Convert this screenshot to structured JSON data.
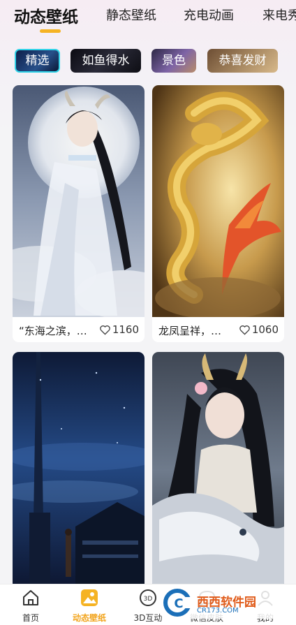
{
  "top_tabs": [
    {
      "label": "动态壁纸",
      "active": true
    },
    {
      "label": "静态壁纸",
      "active": false
    },
    {
      "label": "充电动画",
      "active": false
    },
    {
      "label": "来电秀",
      "active": false
    }
  ],
  "chips": [
    {
      "label": "精选",
      "selected": true,
      "color": "#1c2a52"
    },
    {
      "label": "如鱼得水",
      "selected": false,
      "color": "#1b1b24"
    },
    {
      "label": "景色",
      "selected": false,
      "color": "#5a4a7a"
    },
    {
      "label": "恭喜发财",
      "selected": false,
      "color": "#8a6a48"
    }
  ],
  "cards": [
    {
      "title": "“东海之滨，…",
      "likes": "1160",
      "scene": "moon-maiden-image"
    },
    {
      "title": "龙凤呈祥，…",
      "likes": "1060",
      "scene": "golden-dragon-phoenix-image"
    },
    {
      "title": "",
      "likes": "",
      "scene": "night-tower-city-image"
    },
    {
      "title": "",
      "likes": "",
      "scene": "horned-maiden-white-dragon-image"
    }
  ],
  "bottom_nav": [
    {
      "label": "首页",
      "icon": "home-icon",
      "active": false
    },
    {
      "label": "动态壁纸",
      "icon": "wallpaper-icon",
      "active": true
    },
    {
      "label": "3D互动",
      "icon": "3d-icon",
      "active": false
    },
    {
      "label": "微信皮肤",
      "icon": "wechat-skin-icon",
      "active": false
    },
    {
      "label": "我的",
      "icon": "profile-icon",
      "active": false
    }
  ],
  "watermark": {
    "text": "西西软件园",
    "sub": "CR173.COM",
    "logo": "C"
  },
  "colors": {
    "accent": "#f5b323",
    "active_nav": "#f2a41c",
    "chip_border": "#2fd3e8"
  }
}
